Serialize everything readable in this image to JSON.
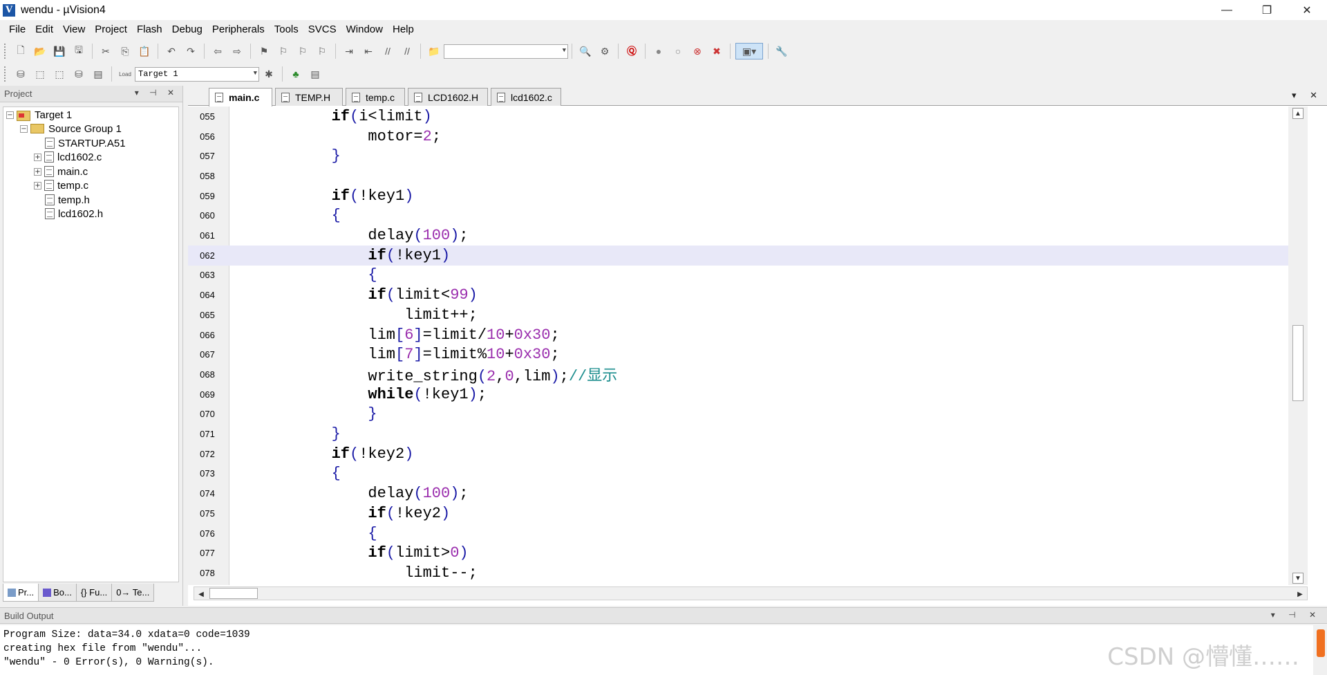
{
  "window": {
    "title": "wendu  - µVision4",
    "app_icon_glyph": "V",
    "minimize": "—",
    "restore": "❐",
    "close": "✕"
  },
  "menu": [
    "File",
    "Edit",
    "View",
    "Project",
    "Flash",
    "Debug",
    "Peripherals",
    "Tools",
    "SVCS",
    "Window",
    "Help"
  ],
  "toolbar": {
    "find_combo_value": "",
    "target_combo_value": "Target 1",
    "load_label": "Load"
  },
  "project_panel": {
    "title": "Project",
    "tree": [
      {
        "label": "Target 1",
        "level": 0,
        "type": "target",
        "expander": "−"
      },
      {
        "label": "Source Group 1",
        "level": 1,
        "type": "folder",
        "expander": "−"
      },
      {
        "label": "STARTUP.A51",
        "level": 2,
        "type": "file",
        "expander": ""
      },
      {
        "label": "lcd1602.c",
        "level": 2,
        "type": "file",
        "expander": "+"
      },
      {
        "label": "main.c",
        "level": 2,
        "type": "file",
        "expander": "+"
      },
      {
        "label": "temp.c",
        "level": 2,
        "type": "file",
        "expander": "+"
      },
      {
        "label": "temp.h",
        "level": 2,
        "type": "file",
        "expander": ""
      },
      {
        "label": "lcd1602.h",
        "level": 2,
        "type": "file",
        "expander": ""
      }
    ],
    "tabs": [
      "Pr...",
      "Bo...",
      "{} Fu...",
      "0→ Te..."
    ]
  },
  "editor": {
    "tabs": [
      "main.c",
      "TEMP.H",
      "temp.c",
      "LCD1602.H",
      "lcd1602.c"
    ],
    "active_tab": "main.c",
    "current_line": "062",
    "lines": [
      {
        "n": "055",
        "indent": 8,
        "tokens": [
          [
            "kw",
            "if"
          ],
          [
            "op",
            "("
          ],
          [
            "t",
            "i<limit"
          ],
          [
            "op",
            ")"
          ]
        ]
      },
      {
        "n": "056",
        "indent": 12,
        "tokens": [
          [
            "t",
            "motor="
          ],
          [
            "num",
            "2"
          ],
          [
            "t",
            ";"
          ]
        ]
      },
      {
        "n": "057",
        "indent": 8,
        "tokens": [
          [
            "op",
            "}"
          ]
        ]
      },
      {
        "n": "058",
        "indent": 0,
        "tokens": []
      },
      {
        "n": "059",
        "indent": 8,
        "tokens": [
          [
            "kw",
            "if"
          ],
          [
            "op",
            "("
          ],
          [
            "t",
            "!key1"
          ],
          [
            "op",
            ")"
          ]
        ]
      },
      {
        "n": "060",
        "indent": 8,
        "tokens": [
          [
            "op",
            "{"
          ]
        ]
      },
      {
        "n": "061",
        "indent": 12,
        "tokens": [
          [
            "t",
            "delay"
          ],
          [
            "op",
            "("
          ],
          [
            "num",
            "100"
          ],
          [
            "op",
            ")"
          ],
          [
            "t",
            ";"
          ]
        ]
      },
      {
        "n": "062",
        "indent": 12,
        "tokens": [
          [
            "kw",
            "if"
          ],
          [
            "op",
            "("
          ],
          [
            "t",
            "!key1"
          ],
          [
            "op",
            ")"
          ]
        ]
      },
      {
        "n": "063",
        "indent": 12,
        "tokens": [
          [
            "op",
            "{"
          ]
        ]
      },
      {
        "n": "064",
        "indent": 12,
        "tokens": [
          [
            "kw",
            "if"
          ],
          [
            "op",
            "("
          ],
          [
            "t",
            "limit<"
          ],
          [
            "num",
            "99"
          ],
          [
            "op",
            ")"
          ]
        ]
      },
      {
        "n": "065",
        "indent": 16,
        "tokens": [
          [
            "t",
            "limit++;"
          ]
        ]
      },
      {
        "n": "066",
        "indent": 12,
        "tokens": [
          [
            "t",
            "lim"
          ],
          [
            "op",
            "["
          ],
          [
            "num",
            "6"
          ],
          [
            "op",
            "]"
          ],
          [
            "t",
            "=limit/"
          ],
          [
            "num",
            "10"
          ],
          [
            "t",
            "+"
          ],
          [
            "num",
            "0x30"
          ],
          [
            "t",
            ";"
          ]
        ]
      },
      {
        "n": "067",
        "indent": 12,
        "tokens": [
          [
            "t",
            "lim"
          ],
          [
            "op",
            "["
          ],
          [
            "num",
            "7"
          ],
          [
            "op",
            "]"
          ],
          [
            "t",
            "=limit%"
          ],
          [
            "num",
            "10"
          ],
          [
            "t",
            "+"
          ],
          [
            "num",
            "0x30"
          ],
          [
            "t",
            ";"
          ]
        ]
      },
      {
        "n": "068",
        "indent": 12,
        "tokens": [
          [
            "t",
            "write_string"
          ],
          [
            "op",
            "("
          ],
          [
            "num",
            "2"
          ],
          [
            "t",
            ","
          ],
          [
            "num",
            "0"
          ],
          [
            "t",
            ",lim"
          ],
          [
            "op",
            ")"
          ],
          [
            "t",
            ";"
          ],
          [
            "cmt",
            "//显示"
          ]
        ]
      },
      {
        "n": "069",
        "indent": 12,
        "tokens": [
          [
            "kw",
            "while"
          ],
          [
            "op",
            "("
          ],
          [
            "t",
            "!key1"
          ],
          [
            "op",
            ")"
          ],
          [
            "t",
            ";"
          ]
        ]
      },
      {
        "n": "070",
        "indent": 12,
        "tokens": [
          [
            "op",
            "}"
          ]
        ]
      },
      {
        "n": "071",
        "indent": 8,
        "tokens": [
          [
            "op",
            "}"
          ]
        ]
      },
      {
        "n": "072",
        "indent": 8,
        "tokens": [
          [
            "kw",
            "if"
          ],
          [
            "op",
            "("
          ],
          [
            "t",
            "!key2"
          ],
          [
            "op",
            ")"
          ]
        ]
      },
      {
        "n": "073",
        "indent": 8,
        "tokens": [
          [
            "op",
            "{"
          ]
        ]
      },
      {
        "n": "074",
        "indent": 12,
        "tokens": [
          [
            "t",
            "delay"
          ],
          [
            "op",
            "("
          ],
          [
            "num",
            "100"
          ],
          [
            "op",
            ")"
          ],
          [
            "t",
            ";"
          ]
        ]
      },
      {
        "n": "075",
        "indent": 12,
        "tokens": [
          [
            "kw",
            "if"
          ],
          [
            "op",
            "("
          ],
          [
            "t",
            "!key2"
          ],
          [
            "op",
            ")"
          ]
        ]
      },
      {
        "n": "076",
        "indent": 12,
        "tokens": [
          [
            "op",
            "{"
          ]
        ]
      },
      {
        "n": "077",
        "indent": 12,
        "tokens": [
          [
            "kw",
            "if"
          ],
          [
            "op",
            "("
          ],
          [
            "t",
            "limit>"
          ],
          [
            "num",
            "0"
          ],
          [
            "op",
            ")"
          ]
        ]
      },
      {
        "n": "078",
        "indent": 16,
        "tokens": [
          [
            "t",
            "limit--;"
          ]
        ]
      }
    ]
  },
  "build_output": {
    "title": "Build Output",
    "lines": [
      "Program Size: data=34.0 xdata=0 code=1039",
      "creating hex file from \"wendu\"...",
      "\"wendu\" - 0 Error(s), 0 Warning(s)."
    ]
  },
  "watermark": "CSDN @懵懂……",
  "colors": {
    "keyword": "#000000",
    "number": "#9b2fae",
    "operator": "#1a1aa6",
    "comment": "#198c8c",
    "current_line": "#e8e8f8"
  }
}
